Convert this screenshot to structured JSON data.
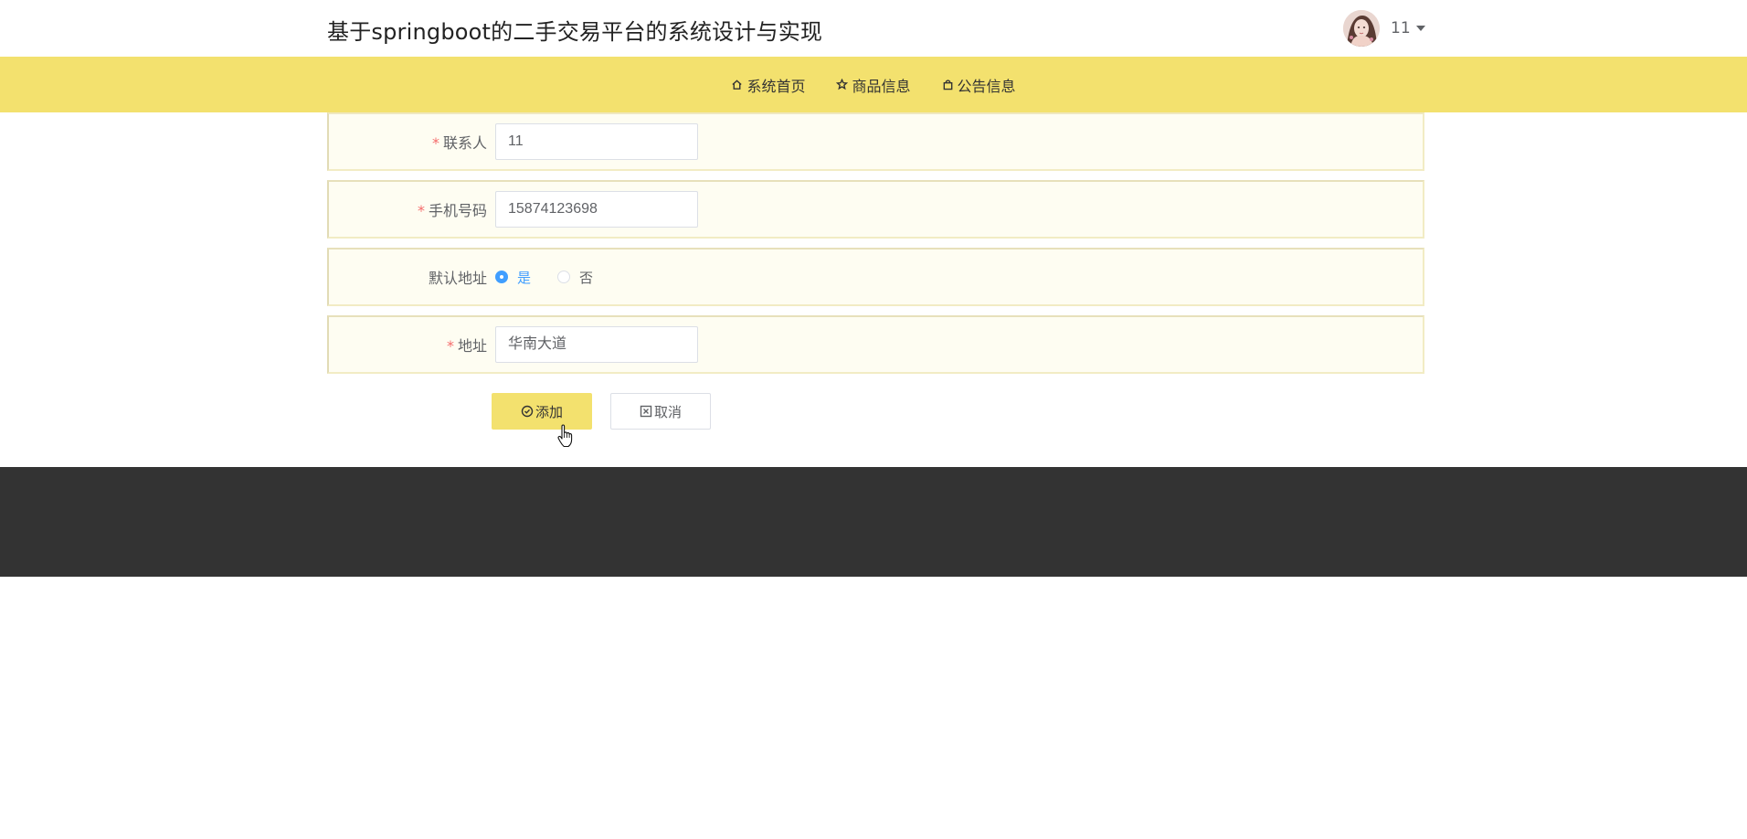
{
  "header": {
    "title": "基于springboot的二手交易平台的系统设计与实现",
    "username": "11"
  },
  "nav": {
    "items": [
      {
        "label": "系统首页",
        "icon": "home-icon"
      },
      {
        "label": "商品信息",
        "icon": "star-icon"
      },
      {
        "label": "公告信息",
        "icon": "bag-icon"
      }
    ]
  },
  "form": {
    "contact": {
      "required_mark": "*",
      "label": "联系人",
      "value": "11"
    },
    "phone": {
      "required_mark": "*",
      "label": "手机号码",
      "value": "15874123698"
    },
    "default_address": {
      "label": "默认地址",
      "options": [
        {
          "label": "是",
          "checked": true
        },
        {
          "label": "否",
          "checked": false
        }
      ]
    },
    "address": {
      "required_mark": "*",
      "label": "地址",
      "value": "华南大道"
    }
  },
  "actions": {
    "add_label": "添加",
    "cancel_label": "取消"
  },
  "colors": {
    "accent": "#f3e16e",
    "footer": "#333333",
    "radio_checked": "#409eff",
    "required": "#f56c6c"
  }
}
